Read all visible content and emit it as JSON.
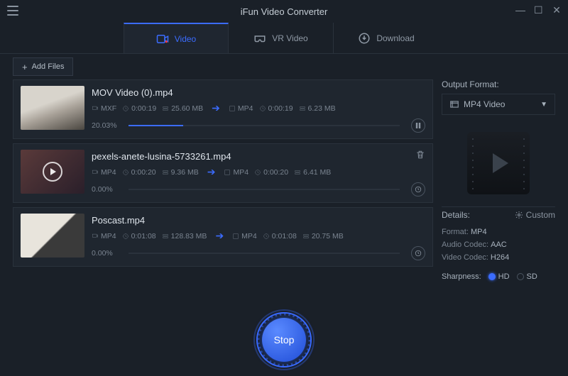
{
  "app": {
    "title": "iFun Video Converter"
  },
  "tabs": [
    {
      "label": "Video",
      "active": true
    },
    {
      "label": "VR Video",
      "active": false
    },
    {
      "label": "Download",
      "active": false
    }
  ],
  "toolbar": {
    "add_label": "Add Files"
  },
  "files": [
    {
      "name": "MOV Video (0).mp4",
      "src_fmt": "MXF",
      "src_dur": "0:00:19",
      "src_size": "25.60 MB",
      "dst_fmt": "MP4",
      "dst_dur": "0:00:19",
      "dst_size": "6.23 MB",
      "pct_label": "20.03%",
      "pct": 20.03,
      "status": "pause",
      "has_trash": false
    },
    {
      "name": "pexels-anete-lusina-5733261.mp4",
      "src_fmt": "MP4",
      "src_dur": "0:00:20",
      "src_size": "9.36 MB",
      "dst_fmt": "MP4",
      "dst_dur": "0:00:20",
      "dst_size": "6.41 MB",
      "pct_label": "0.00%",
      "pct": 0,
      "status": "wait",
      "has_trash": true
    },
    {
      "name": "Poscast.mp4",
      "src_fmt": "MP4",
      "src_dur": "0:01:08",
      "src_size": "128.83 MB",
      "dst_fmt": "MP4",
      "dst_dur": "0:01:08",
      "dst_size": "20.75 MB",
      "pct_label": "0.00%",
      "pct": 0,
      "status": "wait",
      "has_trash": false
    }
  ],
  "output": {
    "label": "Output Format:",
    "selected": "MP4 Video",
    "details_label": "Details:",
    "custom_label": "Custom",
    "fmt_k": "Format:",
    "fmt_v": "MP4",
    "aud_k": "Audio Codec:",
    "aud_v": "AAC",
    "vid_k": "Video Codec:",
    "vid_v": "H264",
    "sharp_label": "Sharpness:",
    "sharp_options": {
      "hd": "HD",
      "sd": "SD"
    },
    "sharp_selected": "HD"
  },
  "footer": {
    "button": "Stop"
  }
}
